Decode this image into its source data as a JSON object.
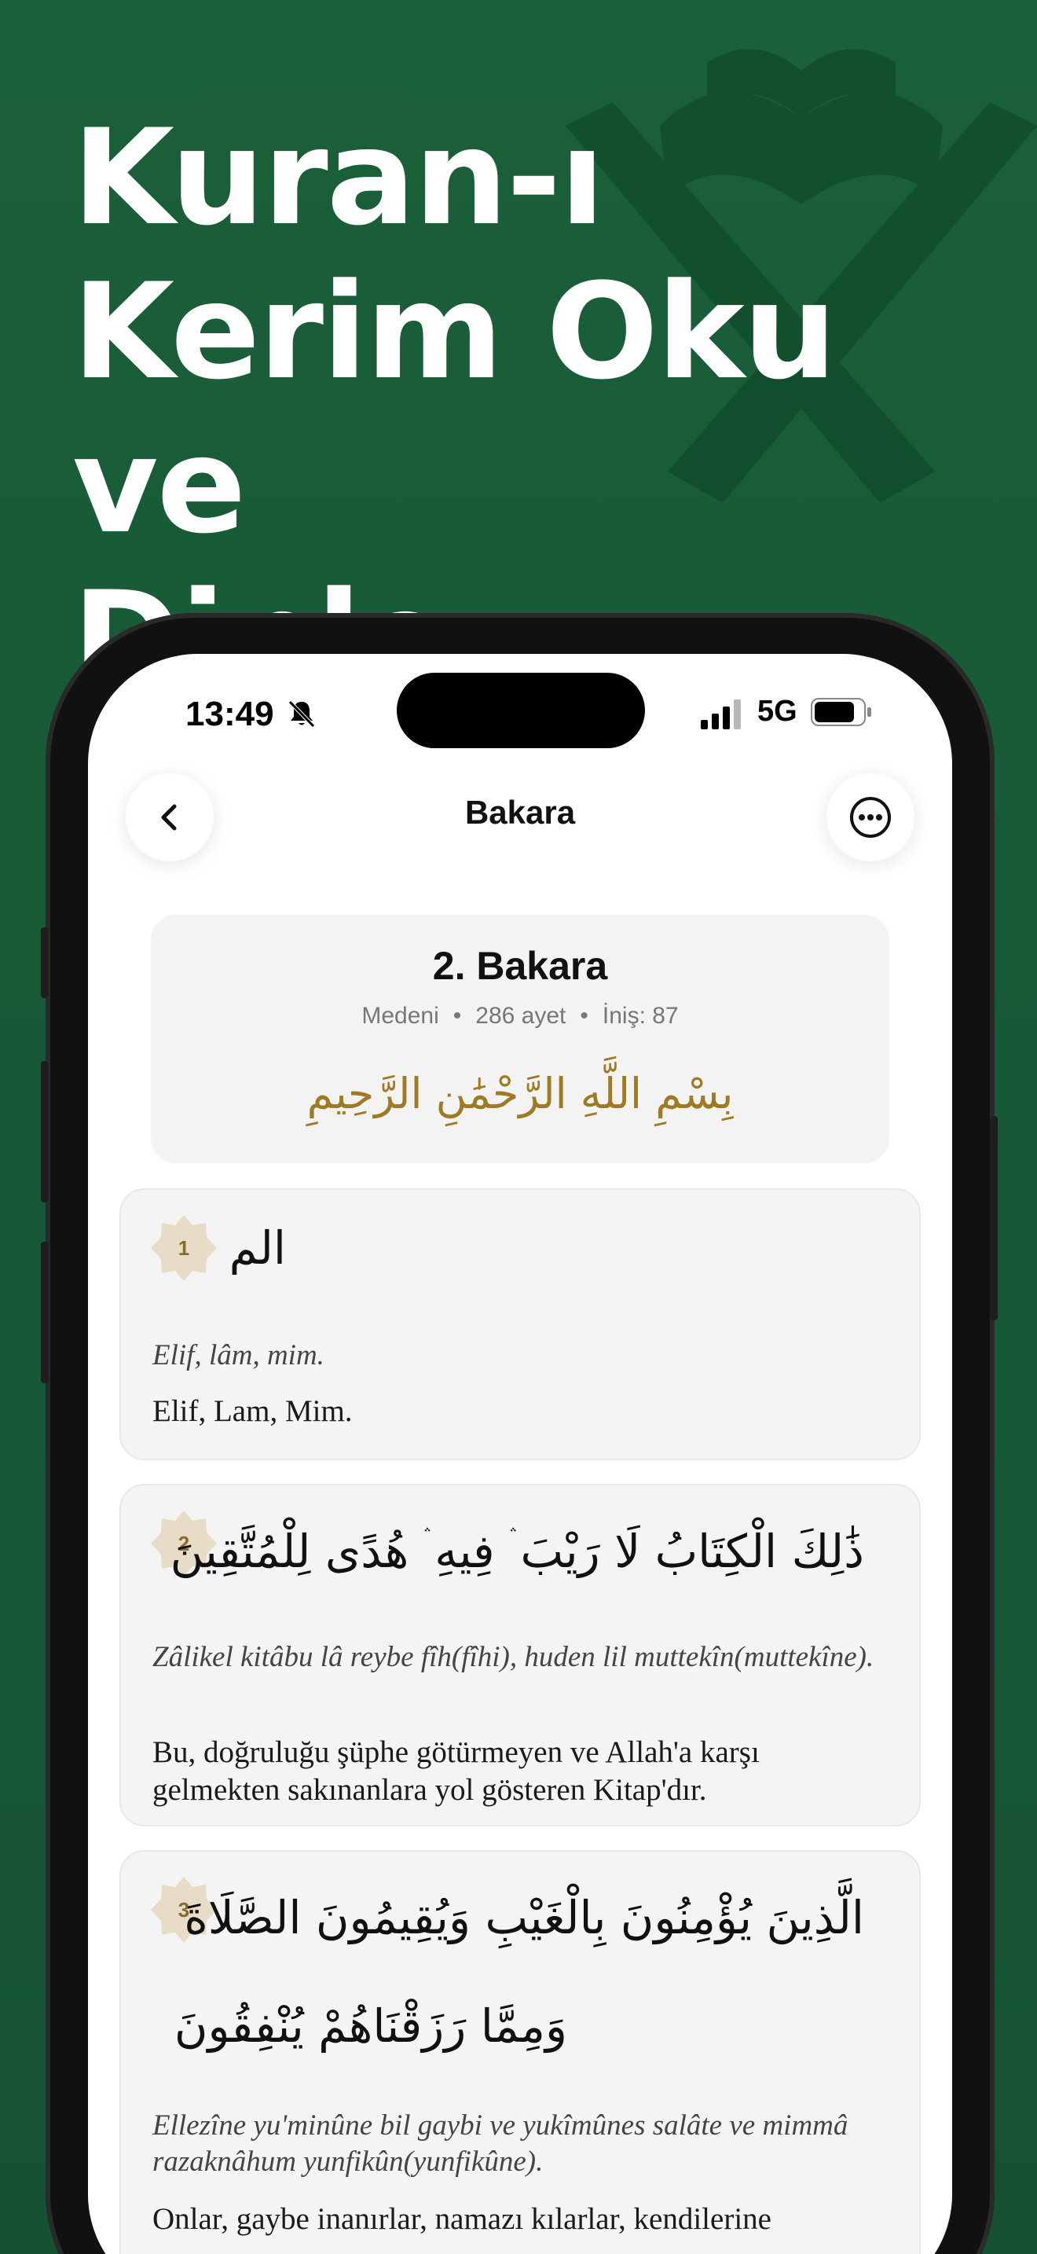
{
  "headline": [
    "Kuran-ı",
    "Kerim Oku ve",
    "Dinle"
  ],
  "status_bar": {
    "time": "13:49",
    "network": "5G",
    "icons": [
      "bell-slash-icon",
      "signal-icon",
      "battery-icon"
    ]
  },
  "nav": {
    "title": "Bakara",
    "back_icon": "chevron-left-icon",
    "more_icon": "more-horizontal-icon"
  },
  "surah": {
    "title": "2. Bakara",
    "place": "Medeni",
    "ayah_count": "286 ayet",
    "revelation": "İniş: 87",
    "basmala": "بِسْمِ اللَّهِ الرَّحْمَٰنِ الرَّحِيمِ"
  },
  "verses": [
    {
      "number": "1",
      "arabic": [
        "الم"
      ],
      "transliteration": "Elif, lâm, mim.",
      "translation": "Elif, Lam, Mim."
    },
    {
      "number": "2",
      "arabic": [
        "ذَٰلِكَ الْكِتَابُ لَا رَيْبَ ۛ فِيهِ ۛ هُدًى لِلْمُتَّقِينَ"
      ],
      "transliteration": "Zâlikel kitâbu lâ reybe fîh(fîhi), huden lil muttekîn(muttekîne).",
      "translation": "Bu, doğruluğu şüphe götürmeyen ve Allah'a karşı gelmekten sakınanlara yol gösteren Kitap'dır."
    },
    {
      "number": "3",
      "arabic": [
        "الَّذِينَ يُؤْمِنُونَ بِالْغَيْبِ وَيُقِيمُونَ الصَّلَاةَ",
        "وَمِمَّا رَزَقْنَاهُمْ يُنْفِقُونَ"
      ],
      "transliteration": "Ellezîne yu'minûne bil gaybi ve yukîmûnes salâte ve mimmâ razaknâhum yunfikûn(yunfikûne).",
      "translation": "Onlar, gaybe inanırlar, namazı kılarlar, kendilerine"
    }
  ],
  "colors": {
    "background": "#175b37",
    "accent_gold": "#a07a23",
    "badge": "#e7dcc6"
  }
}
